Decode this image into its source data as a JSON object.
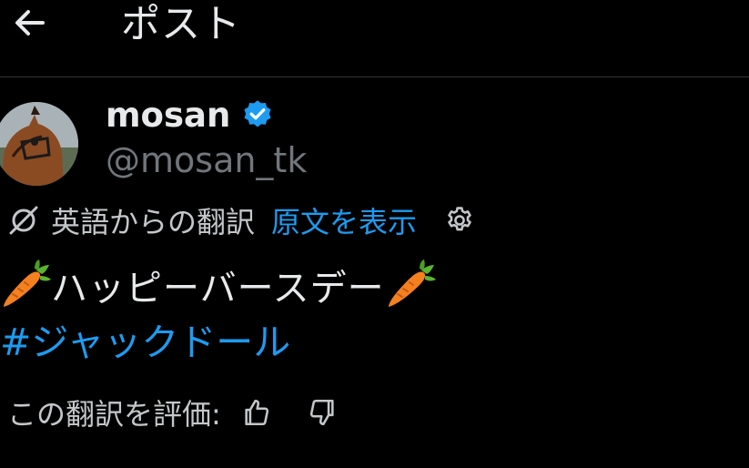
{
  "header": {
    "title": "ポスト"
  },
  "author": {
    "display_name": "mosan",
    "handle": "@mosan_tk",
    "verified": true
  },
  "translation": {
    "label": "英語からの翻訳",
    "show_original": "原文を表示"
  },
  "post": {
    "text": "ハッピーバースデー",
    "hashtag": "#ジャックドール"
  },
  "rating": {
    "label": "この翻訳を評価:"
  },
  "colors": {
    "background": "#000000",
    "text_primary": "#e7e9ea",
    "text_secondary": "#71767b",
    "accent": "#1d9bf0",
    "verified": "#1d9bf0",
    "divider": "#2f3336"
  },
  "icons": {
    "back": "arrow-left-icon",
    "verified": "verified-badge-icon",
    "translate": "translate-icon",
    "settings": "gear-icon",
    "carrot": "carrot-emoji",
    "thumbs_up": "thumbs-up-icon",
    "thumbs_down": "thumbs-down-icon"
  }
}
